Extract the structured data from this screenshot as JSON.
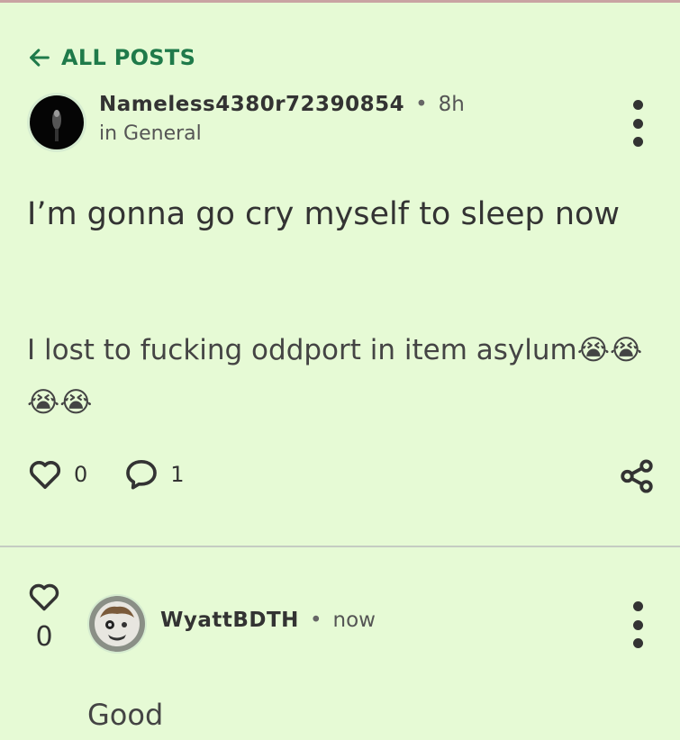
{
  "nav": {
    "back_label": "ALL POSTS"
  },
  "post": {
    "author": "Nameless4380r72390854",
    "separator": "•",
    "time": "8h",
    "community": "in General",
    "title": "I’m gonna go cry myself to sleep now",
    "body": "I lost to fucking oddport in item asylum😭😭😭😭",
    "likes": "0",
    "comments": "1"
  },
  "reply": {
    "author": "WyattBDTH",
    "separator": "•",
    "time": "now",
    "votes": "0",
    "text": "Good"
  },
  "colors": {
    "background": "#e6fad5",
    "accent": "#1f7a4a"
  }
}
